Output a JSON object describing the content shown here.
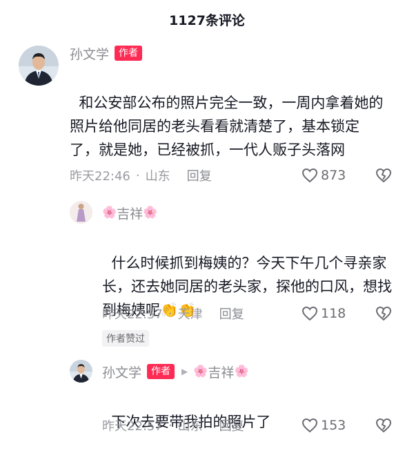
{
  "header": {
    "title": "1127条评论"
  },
  "comments": [
    {
      "username": "孙文学",
      "badge": "作者",
      "content": "和公安部公布的照片完全一致，一周内拿着她的照片给他同居的老头看看就清楚了，基本锁定了，就是她，已经被抓，一代人贩子头落网",
      "time": "昨天22:46",
      "location": "山东",
      "reply_label": "回复",
      "likes": "873",
      "avatar_icon": "man-portrait-icon"
    }
  ],
  "replies": [
    {
      "username": "吉祥",
      "deco": "🌸",
      "content": "什么时候抓到梅姨的？今天下午几个寻亲家长，还去她同居的老头家，探他的口风，想找到梅姨呢",
      "emoji": "👏👏",
      "time": "昨天22:57",
      "location": "天津",
      "reply_label": "回复",
      "likes": "118",
      "liked_badge": "作者赞过",
      "avatar_icon": "woman-figure-icon"
    },
    {
      "username": "孙文学",
      "badge": "作者",
      "reply_to": "吉祥",
      "deco": "🌸",
      "content": "下次去要带我拍的照片了",
      "time": "昨天22:57",
      "location": "山东",
      "reply_label": "回复",
      "likes": "153",
      "avatar_icon": "man-portrait-icon"
    }
  ],
  "colors": {
    "accent": "#fe2c55",
    "meta": "#9a9ba1",
    "text": "#161823"
  },
  "separator": "·"
}
